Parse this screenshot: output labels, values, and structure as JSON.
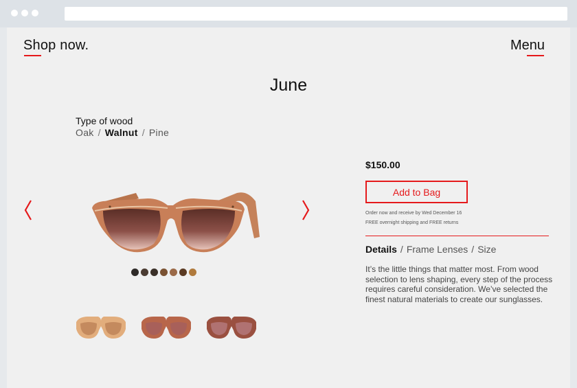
{
  "header": {
    "brand": "Shop now.",
    "menu_label": "Menu"
  },
  "product": {
    "title": "June",
    "wood_label": "Type of wood",
    "wood_options": [
      "Oak",
      "Walnut",
      "Pine"
    ],
    "wood_selected": "Walnut",
    "price": "$150.00",
    "add_to_bag": "Add to Bag",
    "shipping_note_1": "Order now and receive by Wed December 16",
    "shipping_note_2": "FREE overnight shipping and FREE returns",
    "tabs": [
      "Details",
      "Frame Lenses",
      "Size"
    ],
    "tab_selected": "Details",
    "description": "It’s the little things that matter most. From wood selection to lens shaping, every step of the process requires careful consideration. We’ve selected the finest natural materials to create  our sunglasses."
  },
  "colors": {
    "accent": "#e5191b"
  },
  "swatch_colors": [
    "#2e2a28",
    "#4a3b32",
    "#3a3028",
    "#7a5232",
    "#9b6a48",
    "#5a3a22",
    "#b07a3c"
  ],
  "icons": {
    "prev": "chevron-left-icon",
    "next": "chevron-right-icon"
  }
}
